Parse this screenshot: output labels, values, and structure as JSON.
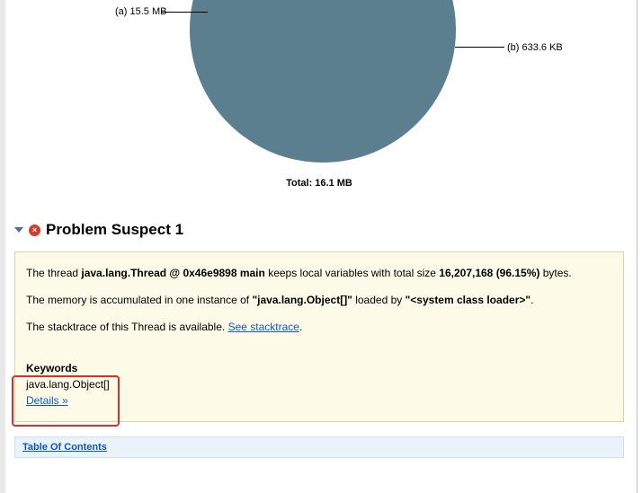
{
  "chart_data": {
    "type": "pie",
    "series": [
      {
        "name": "a",
        "label": "15.5 MB",
        "value_mb": 15.5
      },
      {
        "name": "b",
        "label": "633.6 KB",
        "value_mb": 0.619
      }
    ],
    "total_label": "Total: 16.1 MB",
    "total_mb": 16.1
  },
  "section": {
    "title": "Problem Suspect 1"
  },
  "suspect": {
    "p1_prefix": "The thread ",
    "p1_bold1": "java.lang.Thread @ 0x46e9898 main",
    "p1_mid": " keeps local variables with total size ",
    "p1_bold2": "16,207,168 (96.15%)",
    "p1_suffix": " bytes.",
    "p2_prefix": "The memory is accumulated in one instance of ",
    "p2_bold1": "\"java.lang.Object[]\"",
    "p2_mid": " loaded by ",
    "p2_bold2": "\"<system class loader>\"",
    "p2_suffix": ".",
    "p3_prefix": "The stacktrace of this Thread is available. ",
    "p3_link": "See stacktrace",
    "p3_suffix": ".",
    "keywords_heading": "Keywords",
    "keyword1": "java.lang.Object[]",
    "details_link": "Details »"
  },
  "toc": {
    "label": "Table Of Contents"
  }
}
